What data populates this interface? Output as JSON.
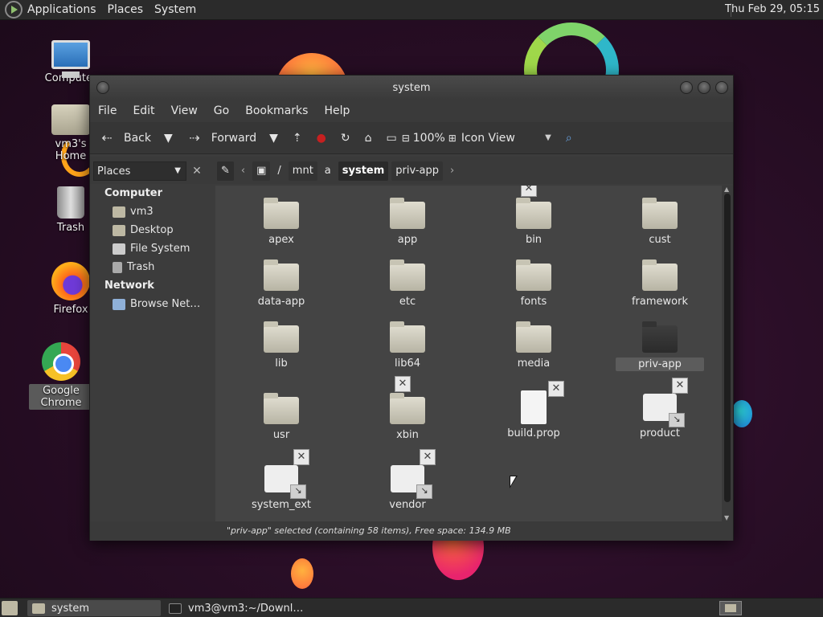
{
  "top_panel": {
    "menus": [
      "Applications",
      "Places",
      "System"
    ],
    "clock": "Thu Feb 29, 05:15"
  },
  "desktop_icons": [
    {
      "label": "Computer",
      "icon": "computer-icon"
    },
    {
      "label": "vm3's Home",
      "icon": "home-folder-icon"
    },
    {
      "label": "Trash",
      "icon": "trash-icon"
    },
    {
      "label": "Firefox",
      "icon": "firefox-icon"
    },
    {
      "label": "Google Chrome",
      "icon": "chrome-icon"
    }
  ],
  "window": {
    "title": "system",
    "menu": [
      "File",
      "Edit",
      "View",
      "Go",
      "Bookmarks",
      "Help"
    ],
    "toolbar": {
      "back": "Back",
      "forward": "Forward",
      "zoom": "100%",
      "view_mode": "Icon View"
    },
    "sidebar": {
      "selector": "Places",
      "sections": [
        {
          "heading": "Computer",
          "items": [
            "vm3",
            "Desktop",
            "File System",
            "Trash"
          ]
        },
        {
          "heading": "Network",
          "items": [
            "Browse Net…"
          ]
        }
      ]
    },
    "breadcrumbs": [
      "/",
      "mnt",
      "a",
      "system",
      "priv-app"
    ],
    "active_crumb": "system",
    "files": [
      {
        "name": "apex",
        "kind": "folder"
      },
      {
        "name": "app",
        "kind": "folder"
      },
      {
        "name": "bin",
        "kind": "folder",
        "locked": true
      },
      {
        "name": "cust",
        "kind": "folder"
      },
      {
        "name": "data-app",
        "kind": "folder"
      },
      {
        "name": "etc",
        "kind": "folder"
      },
      {
        "name": "fonts",
        "kind": "folder"
      },
      {
        "name": "framework",
        "kind": "folder"
      },
      {
        "name": "lib",
        "kind": "folder"
      },
      {
        "name": "lib64",
        "kind": "folder"
      },
      {
        "name": "media",
        "kind": "folder"
      },
      {
        "name": "priv-app",
        "kind": "folder",
        "selected": true
      },
      {
        "name": "usr",
        "kind": "folder"
      },
      {
        "name": "xbin",
        "kind": "folder",
        "locked": true
      },
      {
        "name": "build.prop",
        "kind": "file",
        "locked": true
      },
      {
        "name": "product",
        "kind": "link",
        "locked": true
      },
      {
        "name": "system_ext",
        "kind": "link",
        "locked": true
      },
      {
        "name": "vendor",
        "kind": "link",
        "locked": true
      }
    ],
    "status": "\"priv-app\" selected (containing 58 items), Free space: 134.9 MB"
  },
  "taskbar": {
    "tasks": [
      "system",
      "vm3@vm3:~/Downl…"
    ]
  },
  "colors": {
    "window_bg": "#3c3c3c",
    "content_bg": "#444444",
    "panel_bg": "#2b2b2b"
  }
}
